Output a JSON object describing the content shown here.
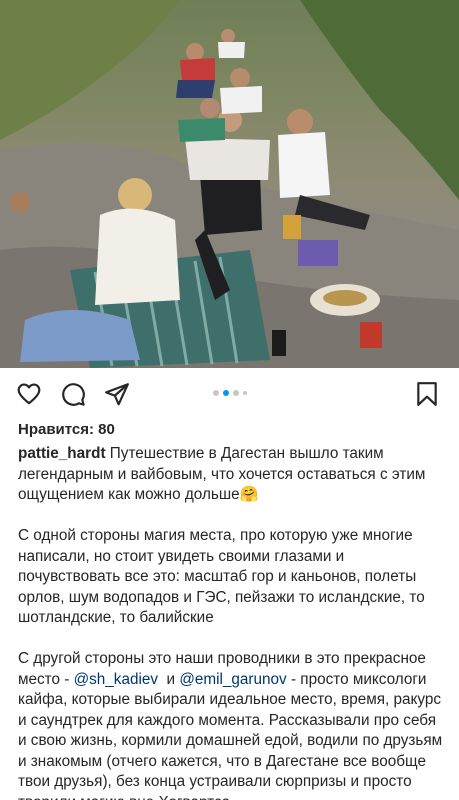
{
  "post": {
    "image_alt": "Group of people sitting on a rocky mountain ledge with a picnic blanket",
    "carousel": {
      "count": 4,
      "active_index": 1
    },
    "likes_label": "Нравится: 80",
    "username": "pattie_hardt",
    "caption_first": "Путешествие в Дагестан вышло таким легендарным и вайбовым, что хочется оставаться с этим ощущением как можно дольше",
    "caption_emoji": "🤗",
    "paragraph_2": "С одной стороны магия места, про которую уже многие написали, но стоит увидеть своими глазами и почувствовать все это: масштаб гор и каньонов, полеты орлов, шум водопадов и ГЭС, пейзажи то исландские, то шотландские, то балийские",
    "paragraph_3_start": "С другой стороны это наши проводники в это прекрасное место - ",
    "mention_1": "@sh_kadiev",
    "paragraph_3_and": "  и ",
    "mention_2": "@emil_garunov",
    "paragraph_3_end": " - просто миксологи кайфа, которые выбирали идеальное место, время, ракурс и саундтрек для каждого момента. Рассказывали про себя и свою жизнь, кормили домашней едой, водили по друзьям и знакомым (отчего кажется, что в Дагестане все вообще твои друзья), без конца устраивали сюрпризы и просто творили магию вне Хогвартса."
  },
  "icons": {
    "like": "heart-icon",
    "comment": "comment-icon",
    "share": "paper-plane-icon",
    "save": "bookmark-icon"
  },
  "colors": {
    "accent": "#0095f6",
    "mention": "#00376b",
    "text": "#262626",
    "dot_inactive": "#c7c7c7"
  }
}
